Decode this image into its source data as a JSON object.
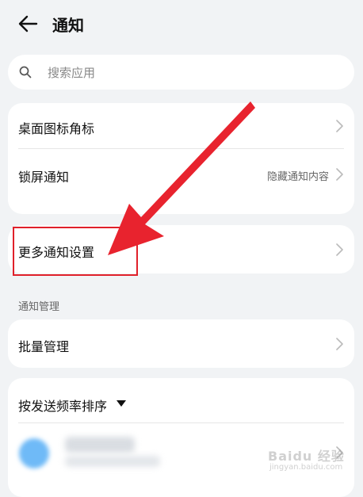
{
  "header": {
    "title": "通知"
  },
  "search": {
    "placeholder": "搜索应用"
  },
  "card1": {
    "rows": [
      {
        "label": "桌面图标角标",
        "value": ""
      },
      {
        "label": "锁屏通知",
        "value": "隐藏通知内容"
      }
    ]
  },
  "card2": {
    "label": "更多通知设置"
  },
  "section": {
    "label": "通知管理"
  },
  "card3": {
    "label": "批量管理"
  },
  "card4": {
    "sort_label": "按发送频率排序"
  },
  "watermark": {
    "text": "Baidu 经验",
    "sub": "jingyan.baidu.com"
  },
  "colors": {
    "background": "#f1f3f5",
    "card": "#ffffff",
    "annotation": "#e0202a",
    "app_icon": "#6fbaf7"
  },
  "icons": {
    "back": "back-arrow-icon",
    "search": "search-icon",
    "chevron": "chevron-right-icon",
    "caret": "caret-down-icon"
  }
}
